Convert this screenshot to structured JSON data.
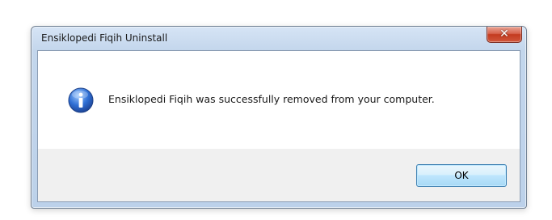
{
  "window": {
    "title": "Ensiklopedi Fiqih Uninstall",
    "close_icon": "close-icon"
  },
  "dialog": {
    "icon": "info-icon",
    "message": "Ensiklopedi Fiqih was successfully removed from your computer.",
    "ok_label": "OK"
  },
  "colors": {
    "info_icon_blue": "#2f6fd4",
    "close_button_red": "#c33a1f",
    "ok_button_border": "#3c7fb1"
  }
}
